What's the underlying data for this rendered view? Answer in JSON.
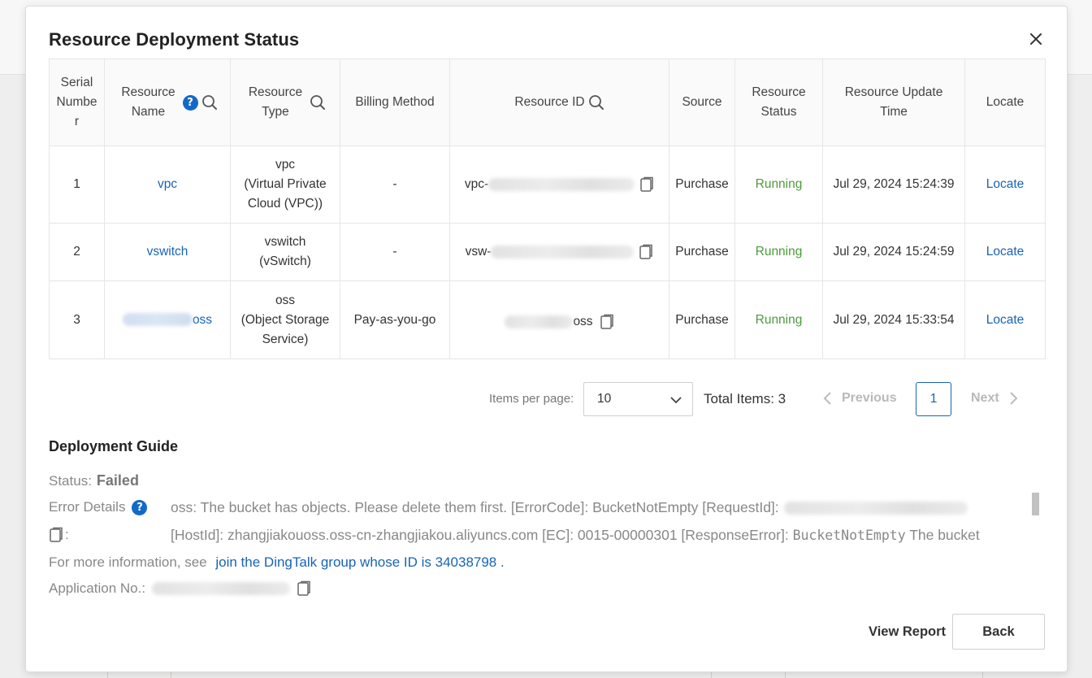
{
  "dialog": {
    "title": "Resource Deployment Status",
    "close_label": "×"
  },
  "table": {
    "headers": {
      "serial": "Serial Number",
      "name": "Resource Name",
      "name_help": "?",
      "type": "Resource Type",
      "billing": "Billing Method",
      "id": "Resource ID",
      "source": "Source",
      "status": "Resource Status",
      "update_time": "Resource Update Time",
      "locate": "Locate"
    },
    "rows": [
      {
        "serial": "1",
        "name": "vpc",
        "type_code": "vpc",
        "type_desc": "(Virtual Private Cloud (VPC))",
        "billing": "-",
        "id_prefix": "vpc-",
        "id_suffix": "",
        "source": "Purchase",
        "status": "Running",
        "update_time": "Jul 29, 2024 15:24:39",
        "locate": "Locate"
      },
      {
        "serial": "2",
        "name": "vswitch",
        "type_code": "vswitch",
        "type_desc": "(vSwitch)",
        "billing": "-",
        "id_prefix": "vsw-",
        "id_suffix": "",
        "source": "Purchase",
        "status": "Running",
        "update_time": "Jul 29, 2024 15:24:59",
        "locate": "Locate"
      },
      {
        "serial": "3",
        "name": "oss",
        "type_code": "oss",
        "type_desc": "(Object Storage Service)",
        "billing": "Pay-as-you-go",
        "id_prefix": "",
        "id_suffix": "oss",
        "source": "Purchase",
        "status": "Running",
        "update_time": "Jul 29, 2024 15:33:54",
        "locate": "Locate"
      }
    ]
  },
  "pagination": {
    "items_per_page_label": "Items per page:",
    "items_per_page_value": "10",
    "total_label": "Total Items: 3",
    "previous": "Previous",
    "current_page": "1",
    "next": "Next"
  },
  "guide": {
    "title": "Deployment Guide",
    "status_label": "Status:",
    "status_value": "Failed",
    "error_label": "Error Details",
    "error_help": "?",
    "error_label2": ":",
    "error_line1": "oss: The bucket has objects. Please delete them first. [ErrorCode]: BucketNotEmpty [RequestId]:",
    "error_line2": "[HostId]: zhangjiakouoss.oss-cn-zhangjiakou.aliyuncs.com [EC]: 0015-00000301 [ResponseError]:",
    "error_line2_mono": "BucketNotEmpty",
    "error_line2_tail": "The bucket",
    "more_info_prefix": "For more information, see",
    "more_info_link": "join the DingTalk group whose ID is 34038798",
    "more_info_suffix": ".",
    "app_no_label": "Application No.:"
  },
  "footer": {
    "view_report": "View Report",
    "back": "Back"
  },
  "colors": {
    "link": "#1863b8",
    "running": "#4c9a3b",
    "help_icon": "#1269c8"
  }
}
